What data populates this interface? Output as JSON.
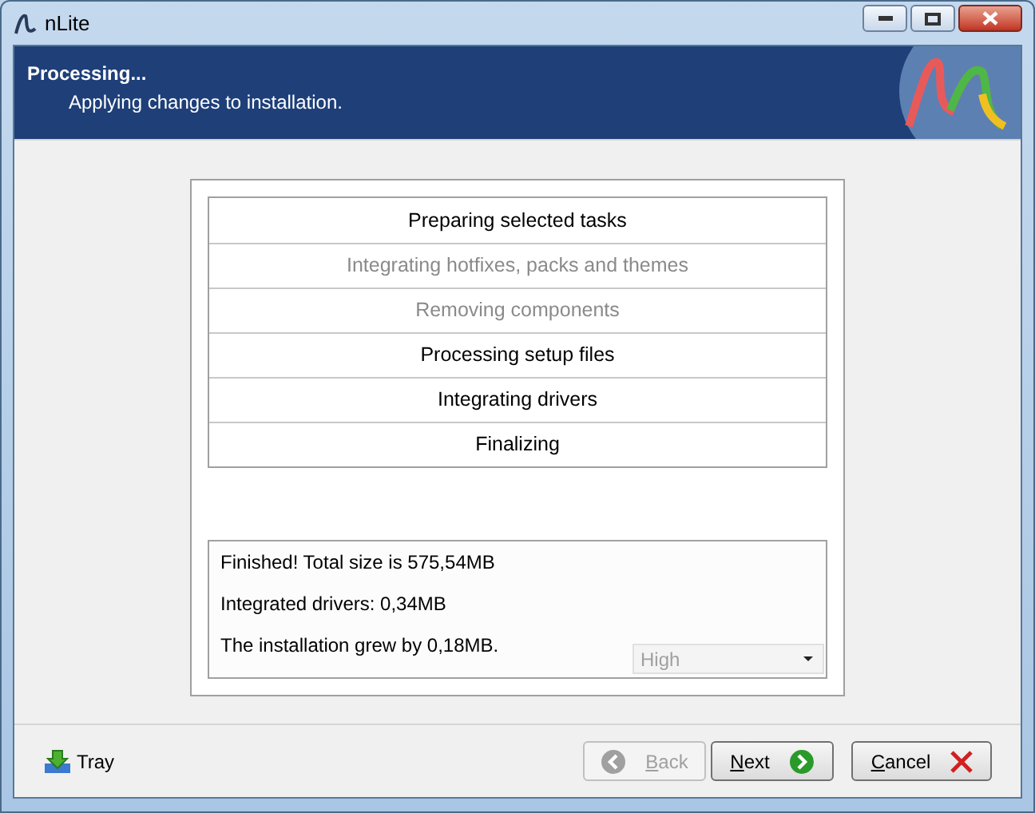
{
  "window": {
    "title": "nLite"
  },
  "header": {
    "title": "Processing...",
    "subtitle": "Applying changes to installation."
  },
  "tasks": [
    {
      "label": "Preparing selected tasks",
      "disabled": false
    },
    {
      "label": "Integrating hotfixes, packs and themes",
      "disabled": true
    },
    {
      "label": "Removing components",
      "disabled": true
    },
    {
      "label": "Processing setup files",
      "disabled": false
    },
    {
      "label": "Integrating drivers",
      "disabled": false
    },
    {
      "label": "Finalizing",
      "disabled": false
    }
  ],
  "log": [
    "Finished! Total size is 575,54MB",
    "Integrated drivers: 0,34MB",
    "The installation grew by 0,18MB."
  ],
  "priority": {
    "value": "High",
    "disabled": true
  },
  "tray": {
    "label": "Tray"
  },
  "buttons": [
    {
      "label": "Back",
      "kind": "back",
      "disabled": true
    },
    {
      "label": "Next",
      "kind": "next",
      "disabled": false
    },
    {
      "label": "Cancel",
      "kind": "cancel",
      "disabled": false
    }
  ]
}
